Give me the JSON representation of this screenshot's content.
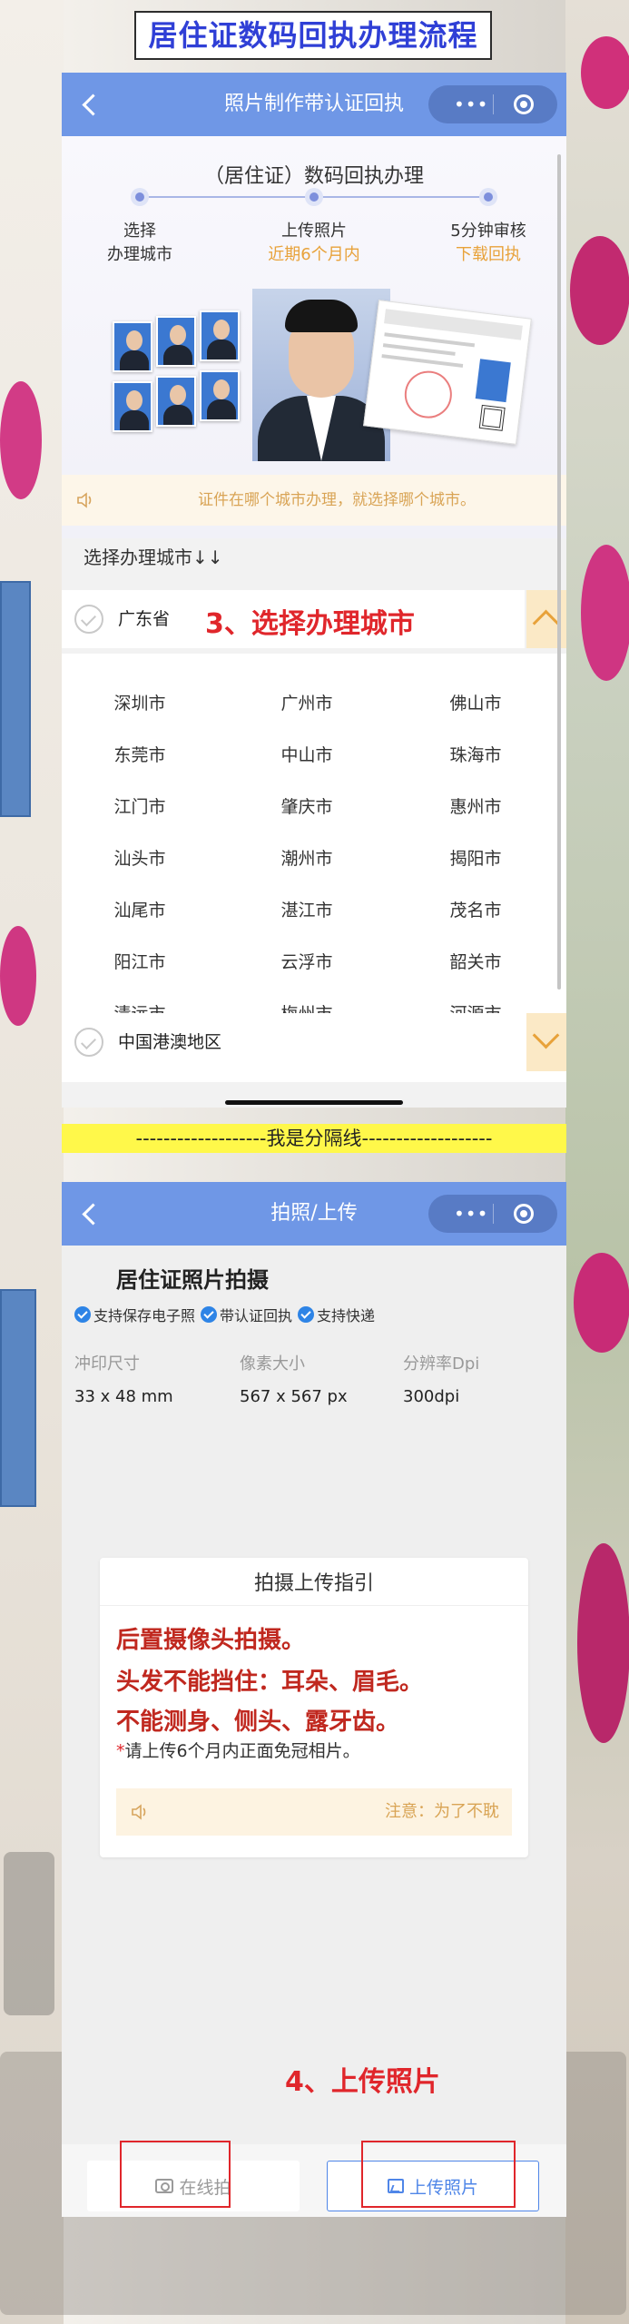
{
  "header": {
    "title": "居住证数码回执办理流程"
  },
  "page1": {
    "nav": {
      "title": "照片制作带认证回执",
      "dots": "•••"
    },
    "steps": {
      "title": "（居住证）数码回执办理",
      "items": [
        {
          "label1": "选择",
          "label2": "办理城市",
          "color": "#333333"
        },
        {
          "label1": "上传照片",
          "label2": "近期6个月内",
          "color": "#e8a23a"
        },
        {
          "label1": "5分钟审核",
          "label2": "下载回执",
          "color": "#e8a23a"
        }
      ]
    },
    "notice": "证件在哪个城市办理，就选择哪个城市。",
    "city_label": "选择办理城市↓↓",
    "province1": "广东省",
    "callout": "3、选择办理城市",
    "cities": [
      [
        "深圳市",
        "广州市",
        "佛山市"
      ],
      [
        "东莞市",
        "中山市",
        "珠海市"
      ],
      [
        "江门市",
        "肇庆市",
        "惠州市"
      ],
      [
        "汕头市",
        "潮州市",
        "揭阳市"
      ],
      [
        "汕尾市",
        "湛江市",
        "茂名市"
      ],
      [
        "阳江市",
        "云浮市",
        "韶关市"
      ],
      [
        "清远市",
        "梅州市",
        "河源市"
      ]
    ],
    "province2": "中国港澳地区"
  },
  "divider": "-------------------我是分隔线-------------------",
  "page2": {
    "nav": {
      "title": "拍照/上传",
      "dots": "•••"
    },
    "title": "居住证照片拍摄",
    "badges": [
      "支持保存电子照",
      "带认证回执",
      "支持快递"
    ],
    "specs": [
      {
        "label": "冲印尺寸",
        "value": "33 x 48 mm"
      },
      {
        "label": "像素大小",
        "value": "567 x 567 px"
      },
      {
        "label": "分辨率Dpi",
        "value": "300dpi"
      }
    ],
    "guide": {
      "title": "拍摄上传指引",
      "rules": [
        "后置摄像头拍摄。",
        "头发不能挡住：耳朵、眉毛。",
        "不能测身、侧头、露牙齿。"
      ],
      "note_star": "*",
      "note": "请上传6个月内正面免冠相片。",
      "notice": "注意：为了不耽"
    },
    "callout": "4、上传照片",
    "buttons": {
      "shoot": "在线拍",
      "upload": "上传照片"
    }
  },
  "colors": {
    "nav": "#6f97e6",
    "accent_red": "#e0262b",
    "accent_orange": "#e8a23a",
    "primary_blue": "#4f86e8"
  }
}
